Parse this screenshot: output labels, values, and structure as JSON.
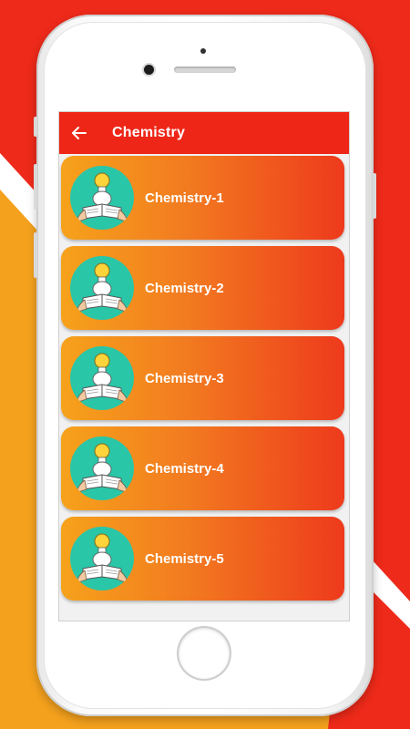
{
  "app_bar": {
    "back_icon": "arrow-left-icon",
    "title": "Chemistry"
  },
  "items": [
    {
      "label": "Chemistry-1",
      "icon": "student-reading-idea-icon"
    },
    {
      "label": "Chemistry-2",
      "icon": "student-reading-idea-icon"
    },
    {
      "label": "Chemistry-3",
      "icon": "student-reading-idea-icon"
    },
    {
      "label": "Chemistry-4",
      "icon": "student-reading-idea-icon"
    },
    {
      "label": "Chemistry-5",
      "icon": "student-reading-idea-icon"
    }
  ],
  "colors": {
    "app_bar": "#ee2617",
    "card_start": "#f6a21b",
    "card_end": "#ee3a1c",
    "avatar_bg": "#29c6a8"
  }
}
